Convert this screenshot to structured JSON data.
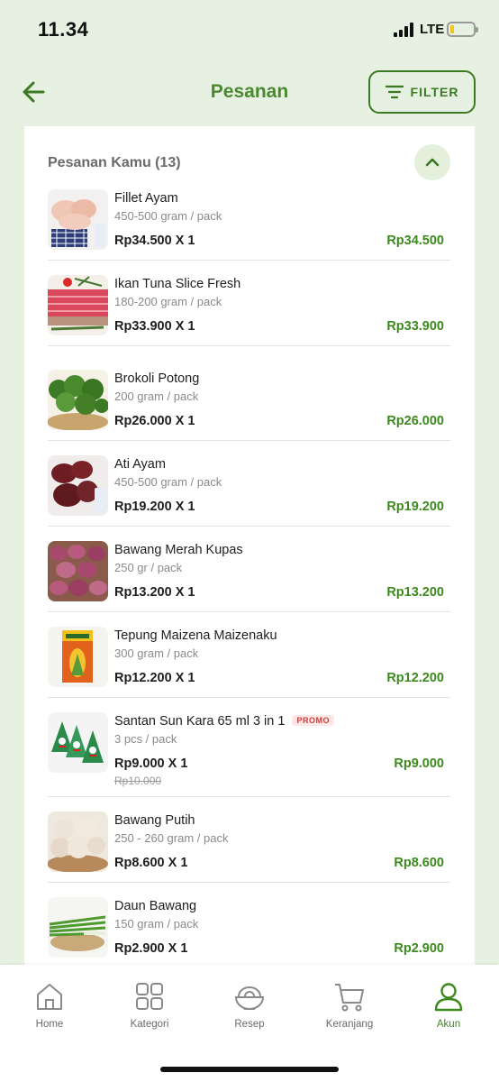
{
  "status_bar": {
    "time": "11.34",
    "network": "LTE",
    "battery_level": 0.15,
    "signal_bars": 4
  },
  "header": {
    "title": "Pesanan",
    "back_icon": "arrow-left-icon",
    "filter_label": "FILTER",
    "filter_icon": "filter-lines-icon"
  },
  "colors": {
    "brand_green": "#3c8a1e",
    "header_bg": "#e7f1e2",
    "promo_red": "#d23a3a"
  },
  "orders": {
    "section_title": "Pesanan Kamu (13)",
    "collapse_icon": "chevron-up-icon",
    "promo_label": "PROMO",
    "items": [
      {
        "name": "Fillet Ayam",
        "pack": "450-500 gram / pack",
        "qty": "Rp34.500 X 1",
        "total": "Rp34.500",
        "image": "chicken-fillet"
      },
      {
        "name": "Ikan Tuna Slice Fresh",
        "pack": "180-200 gram / pack",
        "qty": "Rp33.900 X 1",
        "total": "Rp33.900",
        "image": "tuna-slice"
      },
      {
        "name": "Brokoli Potong",
        "pack": "200 gram / pack",
        "qty": "Rp26.000 X 1",
        "total": "Rp26.000",
        "image": "broccoli"
      },
      {
        "name": "Ati Ayam",
        "pack": "450-500 gram / pack",
        "qty": "Rp19.200 X 1",
        "total": "Rp19.200",
        "image": "chicken-liver"
      },
      {
        "name": "Bawang Merah Kupas",
        "pack": "250 gr / pack",
        "qty": "Rp13.200 X 1",
        "total": "Rp13.200",
        "image": "shallots"
      },
      {
        "name": "Tepung Maizena Maizenaku",
        "pack": "300 gram / pack",
        "qty": "Rp12.200 X 1",
        "total": "Rp12.200",
        "image": "maizena-box"
      },
      {
        "name": "Santan Sun Kara 65 ml 3 in 1",
        "pack": "3 pcs / pack",
        "qty": "Rp9.000 X 1",
        "total": "Rp9.000",
        "old_price": "Rp10.000",
        "promo": true,
        "image": "coconut-milk-packs"
      },
      {
        "name": "Bawang Putih",
        "pack": "250 - 260 gram / pack",
        "qty": "Rp8.600 X 1",
        "total": "Rp8.600",
        "image": "garlic"
      },
      {
        "name": "Daun Bawang",
        "pack": "150 gram / pack",
        "qty": "Rp2.900 X 1",
        "total": "Rp2.900",
        "image": "spring-onion"
      }
    ]
  },
  "bottom_nav": {
    "items": [
      {
        "label": "Home",
        "icon": "home-icon",
        "active": false
      },
      {
        "label": "Kategori",
        "icon": "grid-icon",
        "active": false
      },
      {
        "label": "Resep",
        "icon": "recipe-bowl-icon",
        "active": false
      },
      {
        "label": "Keranjang",
        "icon": "cart-icon",
        "active": false
      },
      {
        "label": "Akun",
        "icon": "user-icon",
        "active": true
      }
    ]
  }
}
